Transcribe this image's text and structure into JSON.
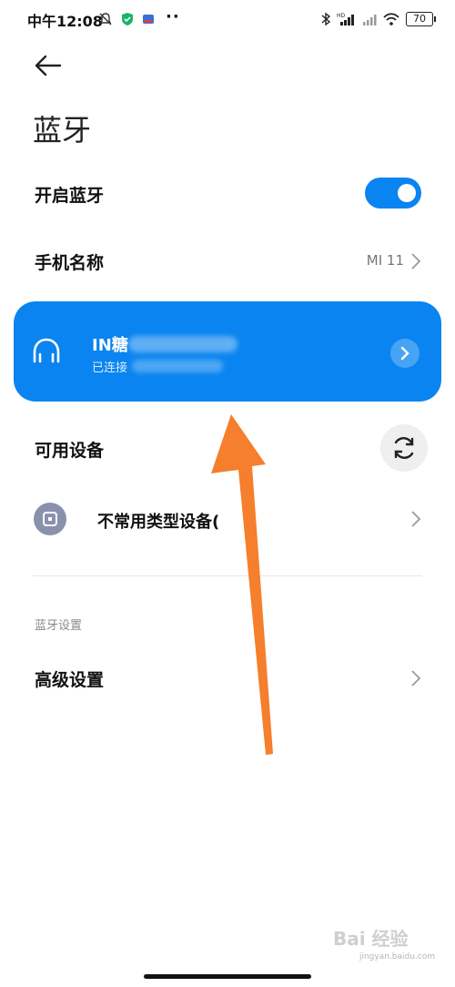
{
  "status_bar": {
    "time": "中午12:08",
    "battery": "70"
  },
  "header": {
    "title": "蓝牙"
  },
  "bluetooth_toggle": {
    "label": "开启蓝牙",
    "state": "on"
  },
  "device_name": {
    "label": "手机名称",
    "value": "MI 11"
  },
  "connected_device": {
    "name": "IN糖",
    "status": "已连接"
  },
  "available_devices": {
    "label": "可用设备",
    "items": [
      {
        "label": "不常用类型设备("
      }
    ]
  },
  "section_header": "蓝牙设置",
  "advanced": {
    "label": "高级设置"
  },
  "watermark": {
    "logo_text": "Bai 经验",
    "url": "jingyan.baidu.com"
  },
  "colors": {
    "accent_blue": "#0a84f0",
    "annotation_orange": "#f57f2c"
  }
}
